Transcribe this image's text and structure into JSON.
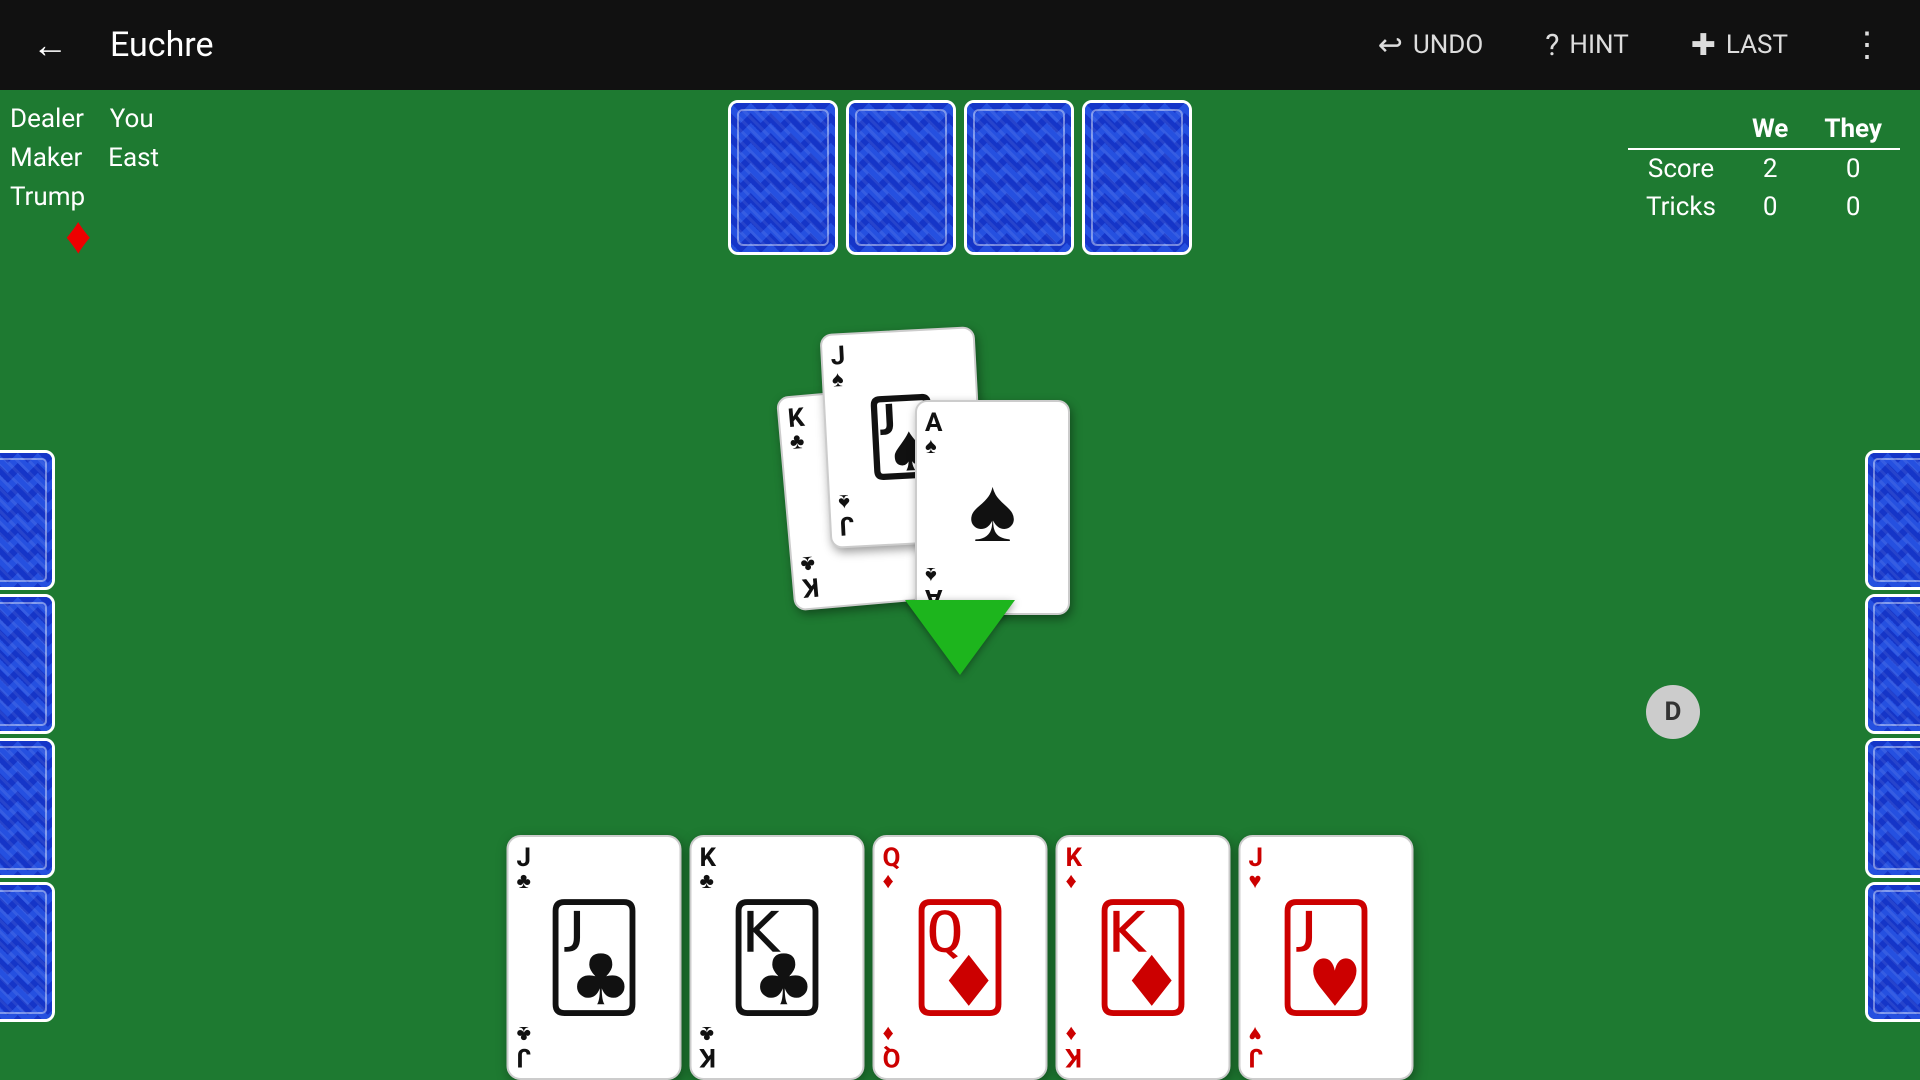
{
  "topbar": {
    "back_label": "←",
    "title": "Euchre",
    "undo_label": "UNDO",
    "hint_label": "HINT",
    "last_label": "LAST",
    "more_label": "⋮",
    "undo_icon": "↩",
    "hint_icon": "?",
    "last_icon": "✚"
  },
  "info": {
    "dealer_label": "Dealer",
    "maker_label": "Maker",
    "you_label": "You",
    "east_label": "East",
    "trump_label": "Trump",
    "trump_symbol": "♦"
  },
  "score": {
    "we_label": "We",
    "they_label": "They",
    "score_label": "Score",
    "tricks_label": "Tricks",
    "we_score": "2",
    "they_score": "0",
    "we_tricks": "0",
    "they_tricks": "0"
  },
  "dealer_badge": "D",
  "north_cards_count": 4,
  "west_cards_count": 4,
  "east_cards_count": 4,
  "center_cards": [
    {
      "rank": "J",
      "suit": "♠",
      "color": "black",
      "label": "Jack of Spades"
    },
    {
      "rank": "K",
      "suit": "♣",
      "color": "black",
      "label": "King of Clubs"
    },
    {
      "rank": "A",
      "suit": "♠",
      "color": "black",
      "label": "Ace of Spades"
    }
  ],
  "player_hand": [
    {
      "rank": "J",
      "suit": "♣",
      "color": "black",
      "label": "Jack of Clubs"
    },
    {
      "rank": "K",
      "suit": "♣",
      "color": "black",
      "label": "King of Clubs"
    },
    {
      "rank": "Q",
      "suit": "♦",
      "color": "red",
      "label": "Queen of Diamonds"
    },
    {
      "rank": "K",
      "suit": "♦",
      "color": "red",
      "label": "King of Diamonds"
    },
    {
      "rank": "J",
      "suit": "♥",
      "color": "red",
      "label": "Jack of Hearts"
    }
  ]
}
